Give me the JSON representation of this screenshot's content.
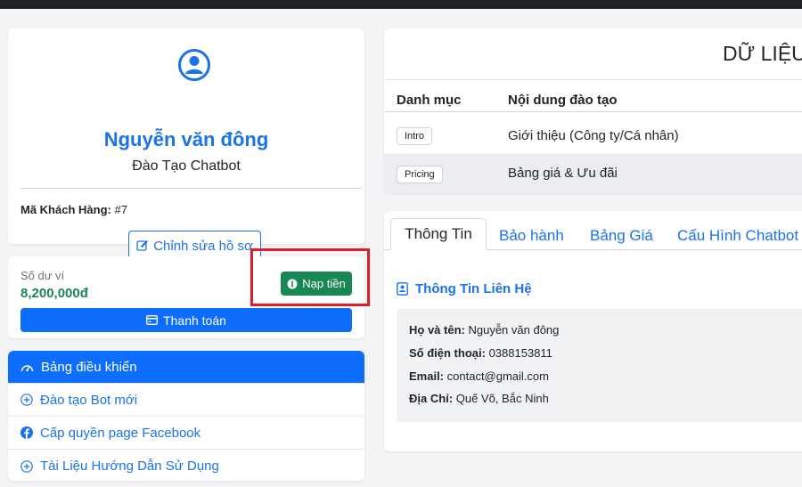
{
  "profile": {
    "name": "Nguyễn văn đông",
    "subtitle": "Đào Tạo Chatbot",
    "customer_id_label": "Mã Khách Hàng:",
    "customer_id_value": "#7",
    "edit_label": "Chỉnh sửa hồ sơ"
  },
  "wallet": {
    "balance_label": "Số dư ví",
    "balance_value": "8,200,000đ",
    "topup_label": "Nạp tiền",
    "pay_label": "Thanh toán"
  },
  "menu": {
    "items": [
      {
        "label": "Bảng điều khiển",
        "icon": "dashboard-icon"
      },
      {
        "label": "Đào tạo Bot mới",
        "icon": "plus-circle-icon"
      },
      {
        "label": "Cấp quyền page Facebook",
        "icon": "facebook-icon"
      },
      {
        "label": "Tài Liệu Hướng Dẫn Sử Dụng",
        "icon": "plus-circle-icon"
      }
    ]
  },
  "data_section": {
    "title": "DỮ LIỆU",
    "columns": [
      "Danh mục",
      "Nội dung đào tạo"
    ],
    "rows": [
      {
        "badge": "Intro",
        "content": "Giới thiệu (Công ty/Cá nhân)"
      },
      {
        "badge": "Pricing",
        "content": "Bảng giá & Ưu đãi"
      }
    ]
  },
  "tabs": {
    "items": [
      "Thông Tin",
      "Bảo hành",
      "Bảng Giá",
      "Cấu Hình Chatbot"
    ],
    "active_index": 0
  },
  "contact": {
    "heading": "Thông Tin Liên Hệ",
    "name_label": "Họ và tên:",
    "name_value": "Nguyễn văn đông",
    "phone_label": "Số điện thoại:",
    "phone_value": "0388153811",
    "email_label": "Email:",
    "email_value": "contact@gmail.com",
    "address_label": "Địa Chỉ:",
    "address_value": "Quế Võ, Bắc Ninh"
  },
  "colors": {
    "primary": "#0d6efd",
    "link": "#1a73e8",
    "success": "#198754",
    "highlight": "#e01e2b"
  }
}
